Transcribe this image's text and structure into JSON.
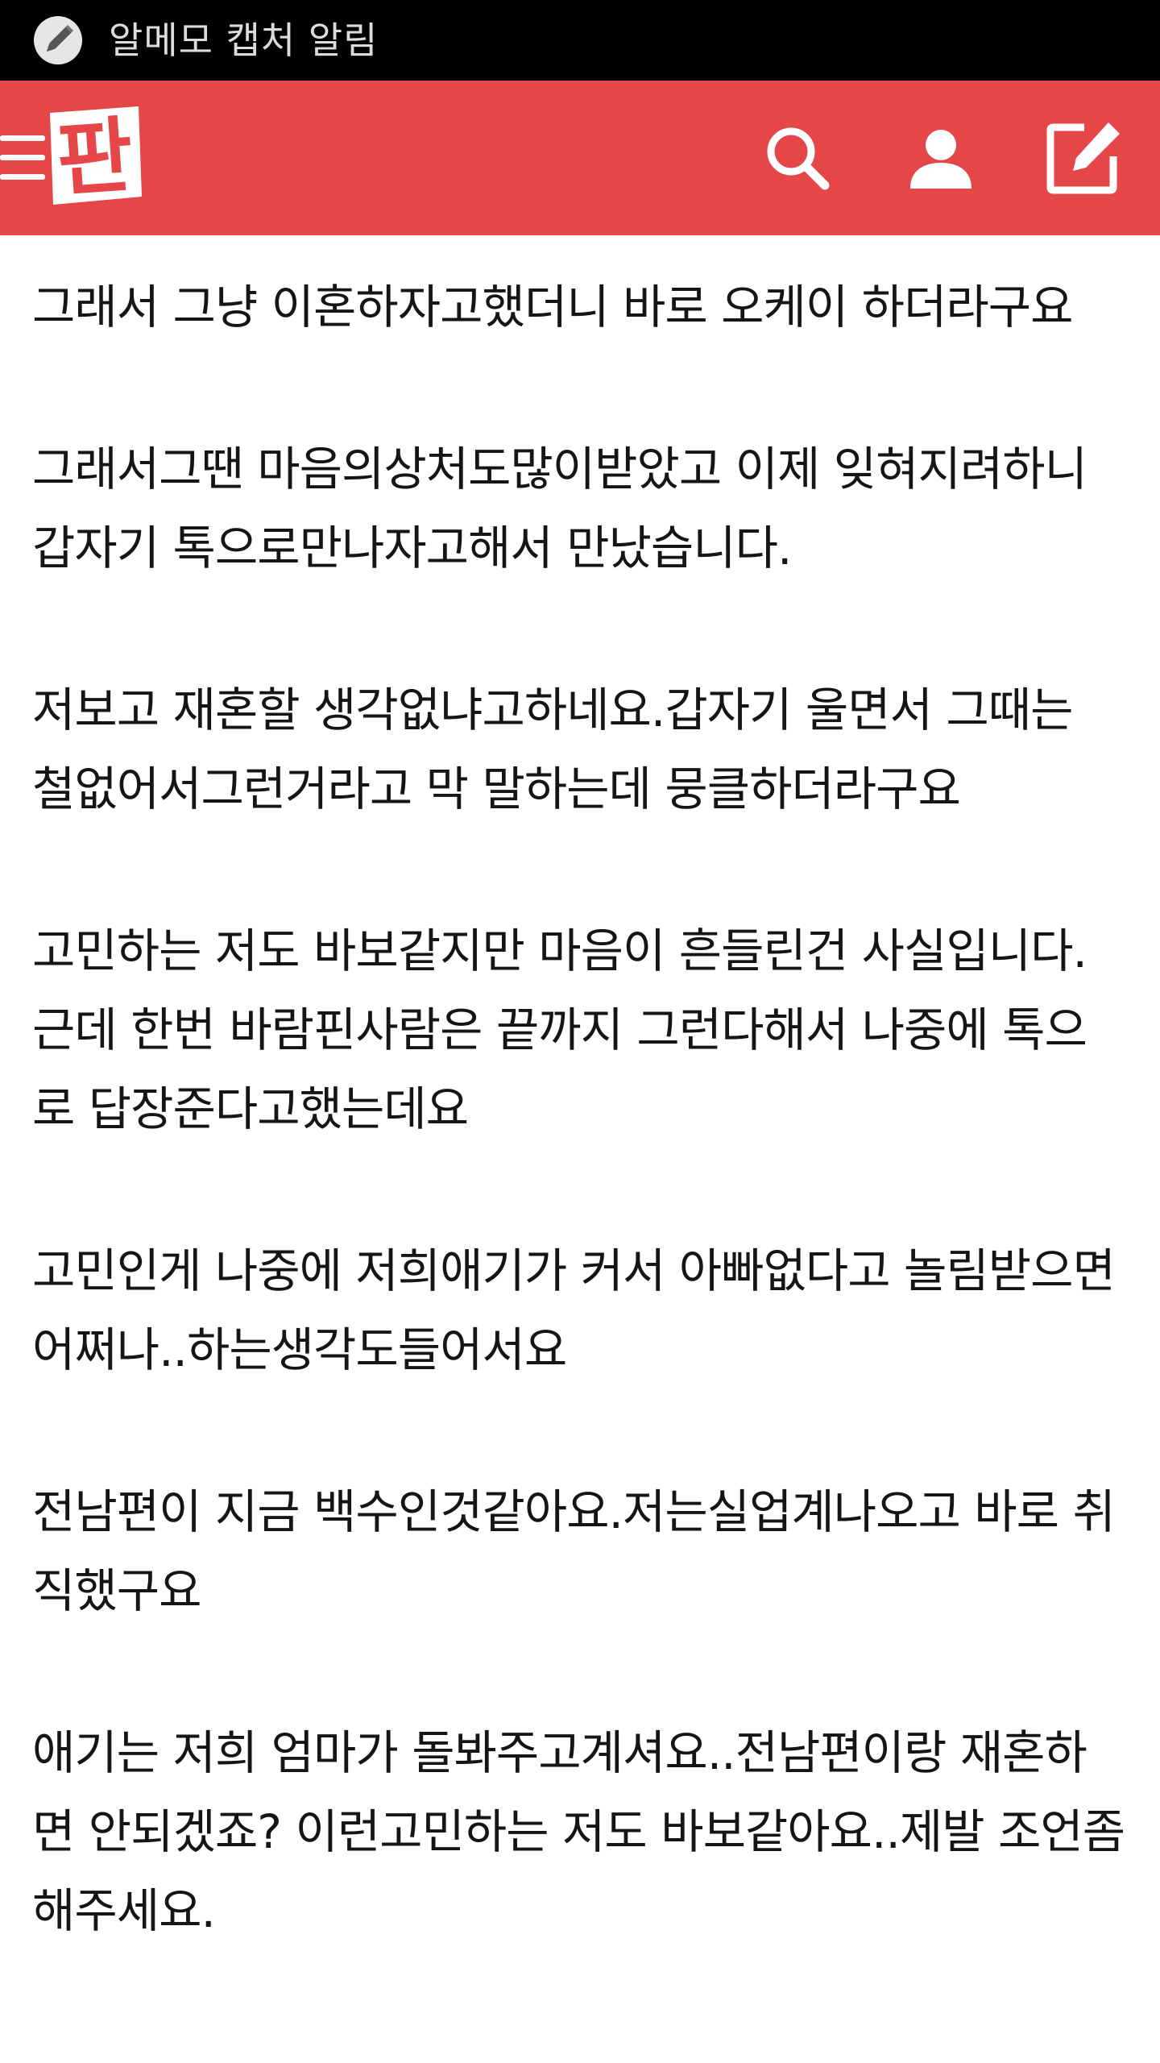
{
  "status_bar": {
    "notification_icon": "pencil-icon",
    "notification_text": "알메모 캡처 알림"
  },
  "header": {
    "logo_text": "판",
    "icons": [
      "menu-icon",
      "search-icon",
      "user-icon",
      "edit-icon"
    ],
    "colors": {
      "background": "#e54648",
      "foreground": "#ffffff"
    }
  },
  "article": {
    "paragraphs": [
      "그래서 그냥 이혼하자고했더니 바로 오케이 하더라구요",
      "그래서그땐 마음의상처도많이받았고 이제 잊혀지려하니 갑자기 톡으로만나자고해서 만났습니다.",
      "저보고 재혼할 생각없냐고하네요.갑자기 울면서 그때는 철없어서그런거라고 막 말하는데 뭉클하더라구요",
      "고민하는 저도 바보같지만 마음이 흔들린건 사실입니다.근데 한번 바람핀사람은 끝까지 그런다해서 나중에 톡으로 답장준다고했는데요",
      "고민인게 나중에 저희애기가 커서 아빠없다고 놀림받으면 어쩌나..하는생각도들어서요",
      "전남편이 지금 백수인것같아요.저는실업계나오고 바로 취직했구요",
      "애기는 저희 엄마가 돌봐주고계셔요..전남편이랑 재혼하면 안되겠죠? 이런고민하는 저도 바보같아요..제발 조언좀해주세요."
    ]
  }
}
